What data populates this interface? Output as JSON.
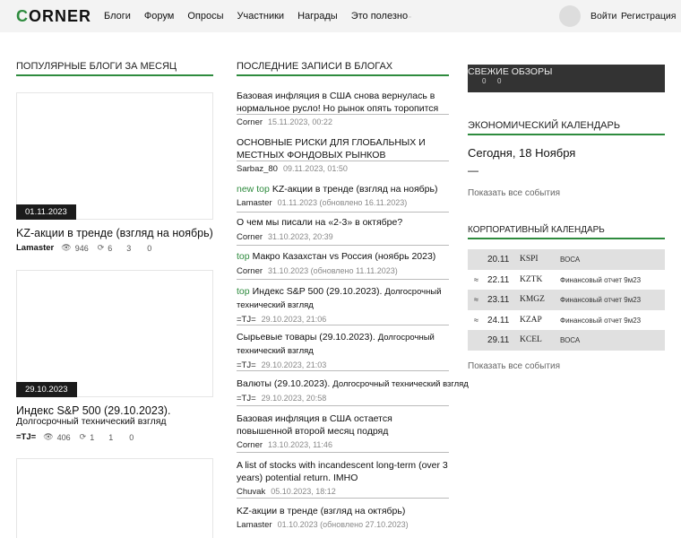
{
  "header": {
    "logo_first": "C",
    "logo_rest": "ORNER",
    "nav": [
      "Блоги",
      "Форум",
      "Опросы",
      "Участники",
      "Награды",
      "Это полезно"
    ],
    "nav_suffix": "▫",
    "login": "Войти",
    "register": "Регистрация"
  },
  "popular": {
    "title": "ПОПУЛЯРНЫЕ БЛОГИ ЗА МЕСЯЦ",
    "items": [
      {
        "date": "01.11.2023",
        "title": "KZ-акции в тренде (взгляд на ноябрь)",
        "subtitle": "",
        "author": "Lamaster",
        "views": "946",
        "reposts": "6",
        "comments": "3",
        "likes": "0"
      },
      {
        "date": "29.10.2023",
        "title": "Индекс S&P 500 (29.10.2023).",
        "subtitle": "Долгосрочный технический взгляд",
        "author": "=TJ=",
        "views": "406",
        "reposts": "1",
        "comments": "1",
        "likes": "0"
      }
    ]
  },
  "latest": {
    "title": "ПОСЛЕДНИЕ ЗАПИСИ В БЛОГАХ",
    "posts": [
      {
        "tag_new": "",
        "tag_top": "",
        "title": "Базовая инфляция в США снова вернулась в нормальное русло! Но рынок опять торопится",
        "author": "Corner",
        "date": "15.11.2023, 00:22"
      },
      {
        "tag_new": "",
        "tag_top": "",
        "title": "ОСНОВНЫЕ РИСКИ ДЛЯ ГЛОБАЛЬНЫХ И МЕСТНЫХ ФОНДОВЫХ РЫНКОВ",
        "author": "Sarbaz_80",
        "date": "09.11.2023, 01:50"
      },
      {
        "tag_new": "new",
        "tag_top": "top",
        "title": "KZ-акции в тренде (взгляд на ноябрь)",
        "author": "Lamaster",
        "date": "01.11.2023 (обновлено 16.11.2023)"
      },
      {
        "tag_new": "",
        "tag_top": "",
        "title": "О чем мы писали на «2-3» в октябре?",
        "author": "Corner",
        "date": "31.10.2023, 20:39"
      },
      {
        "tag_new": "",
        "tag_top": "top",
        "title": "Макро Казахстан vs Россия (ноябрь 2023)",
        "author": "Corner",
        "date": "31.10.2023 (обновлено 11.11.2023)"
      },
      {
        "tag_new": "",
        "tag_top": "top",
        "title": "Индекс S&P 500 (29.10.2023).",
        "title_small": "Долгосрочный технический взгляд",
        "author": "=TJ=",
        "date": "29.10.2023, 21:06"
      },
      {
        "tag_new": "",
        "tag_top": "",
        "title": "Сырьевые товары (29.10.2023).",
        "title_small": "Долгосрочный технический взгляд",
        "author": "=TJ=",
        "date": "29.10.2023, 21:03"
      },
      {
        "tag_new": "",
        "tag_top": "",
        "title": "Валюты (29.10.2023).",
        "title_small": "Долгосрочный технический взгляд",
        "author": "=TJ=",
        "date": "29.10.2023, 20:58"
      },
      {
        "tag_new": "",
        "tag_top": "",
        "title": "Базовая инфляция в США остается повышенной второй месяц подряд",
        "author": "Corner",
        "date": "13.10.2023, 11:46"
      },
      {
        "tag_new": "",
        "tag_top": "",
        "title": "A list of stocks with incandescent long-term (over 3 years) potential return. IMHO",
        "author": "Chuvak",
        "date": "05.10.2023, 18:12"
      },
      {
        "tag_new": "",
        "tag_top": "",
        "title": "KZ-акции в тренде (взгляд на октябрь)",
        "author": "Lamaster",
        "date": "01.10.2023 (обновлено 27.10.2023)"
      }
    ]
  },
  "fresh": {
    "title": "СВЕЖИЕ ОБЗОРЫ",
    "count_a": "0",
    "count_b": "0"
  },
  "econ": {
    "title": "ЭКОНОМИЧЕСКИЙ КАЛЕНДАРЬ",
    "today": "Сегодня, 18 Ноября",
    "dash": "—",
    "show_all": "Показать все события"
  },
  "corp": {
    "title": "КОРПОРАТИВНЫЙ КАЛЕНДАРЬ",
    "rows": [
      {
        "arrow": "",
        "day": "20.11",
        "ticker": "KSPI",
        "event": "ВОСА"
      },
      {
        "arrow": "≈",
        "day": "22.11",
        "ticker": "KZTK",
        "event": "Финансовый отчет 9м23"
      },
      {
        "arrow": "≈",
        "day": "23.11",
        "ticker": "KMGZ",
        "event": "Финансовый отчет 9м23"
      },
      {
        "arrow": "≈",
        "day": "24.11",
        "ticker": "KZAP",
        "event": "Финансовый отчет 9м23"
      },
      {
        "arrow": "",
        "day": "29.11",
        "ticker": "KCEL",
        "event": "ВОСА"
      }
    ],
    "show_all": "Показать все события"
  },
  "colors": {
    "accent": "#2e8b3e",
    "header_bg": "#f3f3f3",
    "dark_box": "#333333",
    "row_shade": "#e0e0e0"
  }
}
